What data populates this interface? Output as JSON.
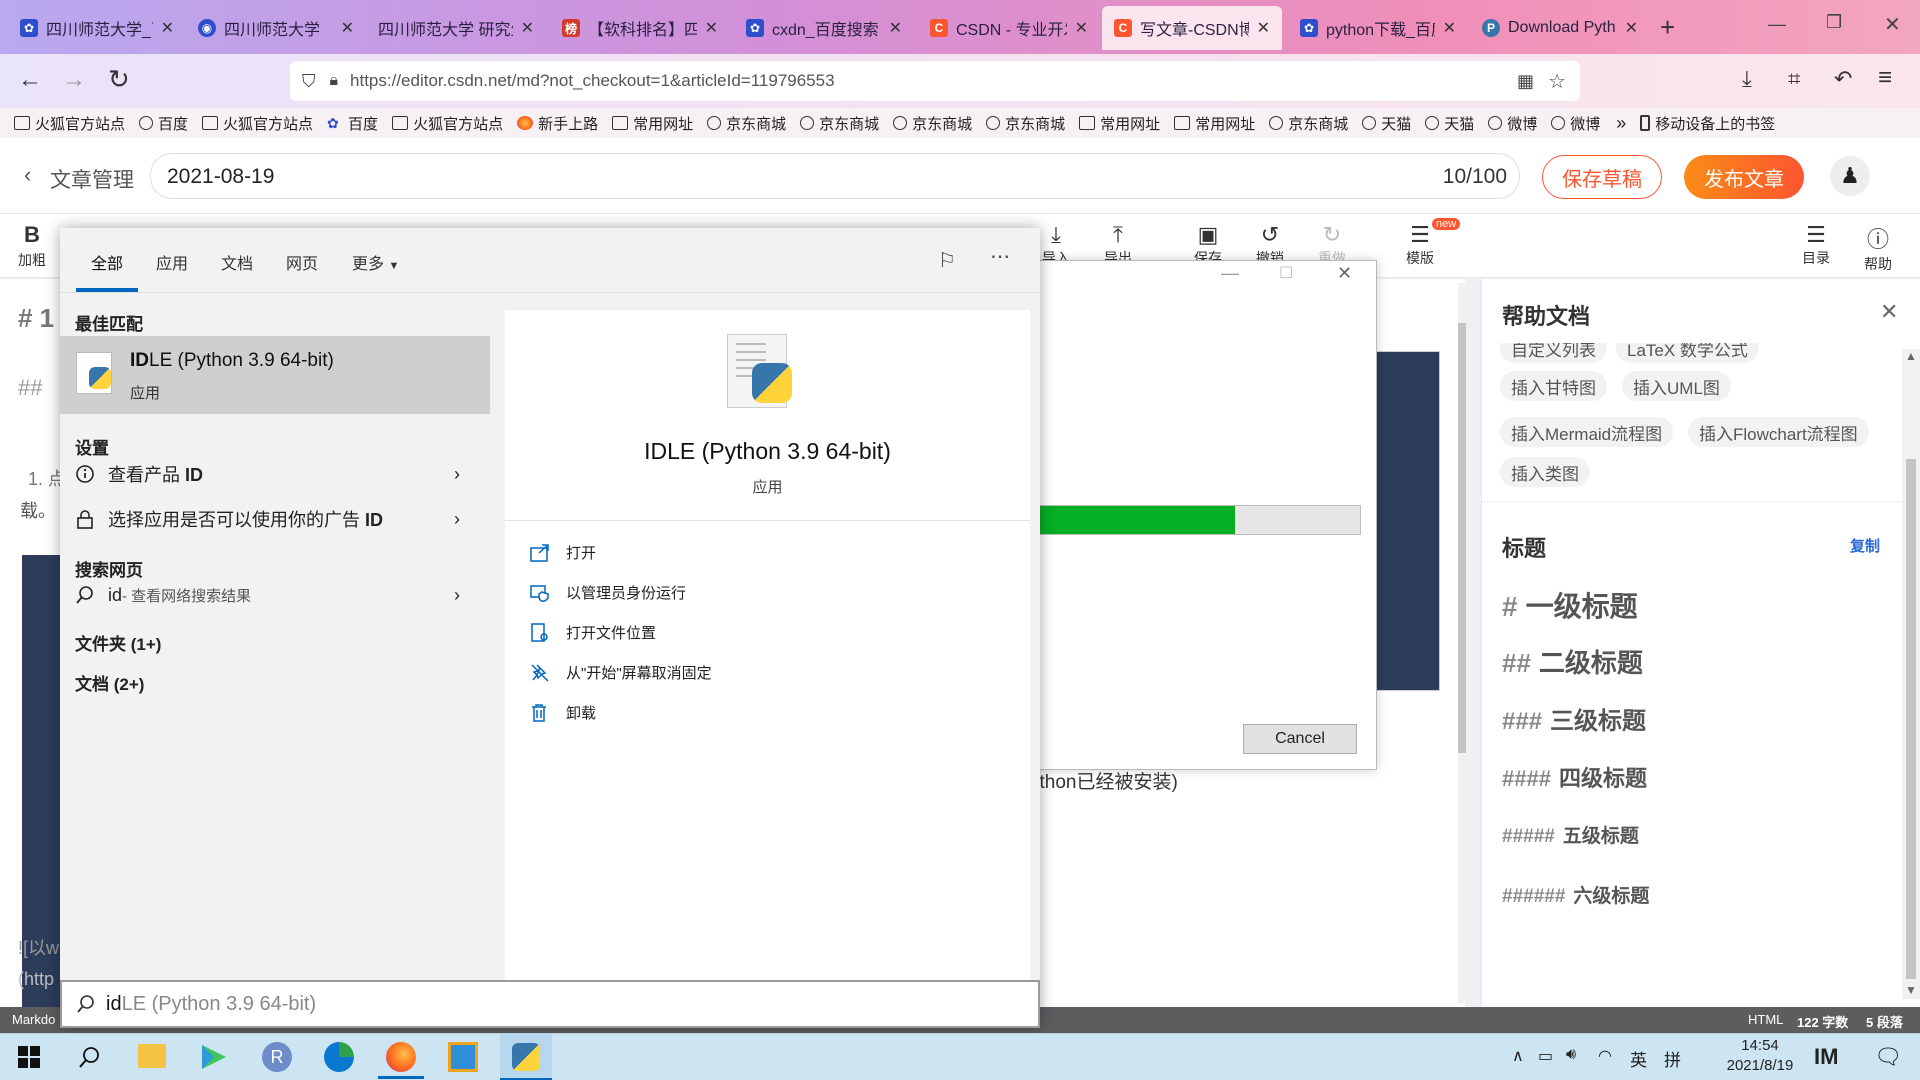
{
  "browser": {
    "tabs": [
      {
        "title": "四川师范大学_百度",
        "icon": "baidu-paw-icon",
        "color": "#2e4ecb",
        "active": false
      },
      {
        "title": "四川师范大学",
        "icon": "school-icon",
        "color": "#2e4ecb",
        "active": false
      },
      {
        "title": "四川师范大学 研究生",
        "icon": "none",
        "color": "#2e4ecb",
        "active": false
      },
      {
        "title": "【软科排名】四川",
        "icon": "ranking-icon",
        "color": "#d43a2a",
        "active": false
      },
      {
        "title": "cxdn_百度搜索",
        "icon": "baidu-paw-icon",
        "color": "#2e4ecb",
        "active": false
      },
      {
        "title": "CSDN - 专业开发",
        "icon": "csdn-icon",
        "color": "#fc5531",
        "active": false
      },
      {
        "title": "写文章-CSDN博",
        "icon": "csdn-icon",
        "color": "#fc5531",
        "active": true
      },
      {
        "title": "python下载_百度",
        "icon": "baidu-paw-icon",
        "color": "#2e4ecb",
        "active": false
      },
      {
        "title": "Download Pyth",
        "icon": "python-icon",
        "color": "#3776ab",
        "active": false
      }
    ],
    "url": "https://editor.csdn.net/md?not_checkout=1&articleId=119796553",
    "url_domain": "csdn.net",
    "bookmarks": [
      {
        "label": "火狐官方站点",
        "icon": "folder-icon"
      },
      {
        "label": "百度",
        "icon": "globe-icon"
      },
      {
        "label": "火狐官方站点",
        "icon": "folder-icon"
      },
      {
        "label": "百度",
        "icon": "baidu-paw-icon"
      },
      {
        "label": "火狐官方站点",
        "icon": "folder-icon"
      },
      {
        "label": "新手上路",
        "icon": "firefox-icon"
      },
      {
        "label": "常用网址",
        "icon": "folder-icon"
      },
      {
        "label": "京东商城",
        "icon": "globe-icon"
      },
      {
        "label": "京东商城",
        "icon": "globe-icon"
      },
      {
        "label": "京东商城",
        "icon": "globe-icon"
      },
      {
        "label": "京东商城",
        "icon": "globe-icon"
      },
      {
        "label": "常用网址",
        "icon": "folder-icon"
      },
      {
        "label": "常用网址",
        "icon": "folder-icon"
      },
      {
        "label": "京东商城",
        "icon": "globe-icon"
      },
      {
        "label": "天猫",
        "icon": "globe-icon"
      },
      {
        "label": "天猫",
        "icon": "globe-icon"
      },
      {
        "label": "微博",
        "icon": "globe-icon"
      },
      {
        "label": "微博",
        "icon": "globe-icon"
      }
    ],
    "bookmarks_overflow": "»",
    "mobile_bookmarks": "移动设备上的书签"
  },
  "editor": {
    "back_label": "文章管理",
    "title_value": "2021-08-19",
    "title_counter": "10/100",
    "save_draft": "保存草稿",
    "publish": "发布文章",
    "toolbar": {
      "bold": "B",
      "bold_label": "加粗",
      "template": "模版",
      "new_badge": "new",
      "toc": "目录",
      "help": "帮助",
      "partial_label_1": "导入",
      "partial_label_2": "导出",
      "partial_label_3": "保存",
      "partial_label_4": "撤销",
      "partial_label_5": "重做"
    },
    "content": {
      "h1": "# 1",
      "h2": "##",
      "step1": "1. 点",
      "step1_tail": "载。",
      "link_text": "![以w",
      "link_text2": "(http",
      "installed_note": "ython已经被安装)"
    },
    "status": {
      "mode": "Markdo",
      "format": "HTML",
      "words": "122 字数",
      "paragraphs": "5 段落"
    }
  },
  "help": {
    "title": "帮助文档",
    "chips": [
      "自定义列表",
      "LaTeX 数学公式",
      "插入甘特图",
      "插入UML图",
      "插入Mermaid流程图",
      "插入Flowchart流程图",
      "插入类图"
    ],
    "heading_section": "标题",
    "copy": "复制",
    "headings": [
      {
        "hash": "#",
        "text": "一级标题"
      },
      {
        "hash": "##",
        "text": "二级标题"
      },
      {
        "hash": "###",
        "text": "三级标题"
      },
      {
        "hash": "####",
        "text": "四级标题"
      },
      {
        "hash": "#####",
        "text": "五级标题"
      },
      {
        "hash": "######",
        "text": "六级标题"
      }
    ]
  },
  "installer": {
    "cancel": "Cancel",
    "progress": 0.62,
    "progress_color": "#06b025",
    "partial_text": ")"
  },
  "search": {
    "tabs": [
      "全部",
      "应用",
      "文档",
      "网页",
      "更多"
    ],
    "best_match_header": "最佳匹配",
    "best_match": {
      "title_bold": "ID",
      "title_rest": "LE (Python 3.9 64-bit)",
      "subtitle": "应用"
    },
    "settings_header": "设置",
    "settings": [
      {
        "label_pre": "查看产品 ",
        "label_bold": "ID",
        "icon": "info-icon"
      },
      {
        "label_pre": "选择应用是否可以使用你的广告 ",
        "label_bold": "ID",
        "icon": "lock-icon"
      }
    ],
    "web_header": "搜索网页",
    "web_item": {
      "query": "id",
      "hint": " - 查看网络搜索结果"
    },
    "folders": "文件夹 (1+)",
    "docs": "文档 (2+)",
    "detail": {
      "title": "IDLE (Python 3.9 64-bit)",
      "subtitle": "应用",
      "actions": [
        {
          "label": "打开",
          "icon": "open-icon"
        },
        {
          "label": "以管理员身份运行",
          "icon": "admin-shield-icon"
        },
        {
          "label": "打开文件位置",
          "icon": "file-location-icon"
        },
        {
          "label": "从\"开始\"屏幕取消固定",
          "icon": "unpin-icon"
        },
        {
          "label": "卸载",
          "icon": "trash-icon"
        }
      ]
    },
    "query_typed": "id",
    "query_suggest": "LE (Python 3.9 64-bit)"
  },
  "taskbar": {
    "time": "14:54",
    "date": "2021/8/19",
    "ime": "英",
    "ime2": "拼",
    "apps": [
      "windows-start-icon",
      "search-icon",
      "file-explorer-icon",
      "media-player-icon",
      "r-app-icon",
      "edge-icon",
      "firefox-icon",
      "remote-desktop-icon",
      "python-installer-icon"
    ]
  }
}
